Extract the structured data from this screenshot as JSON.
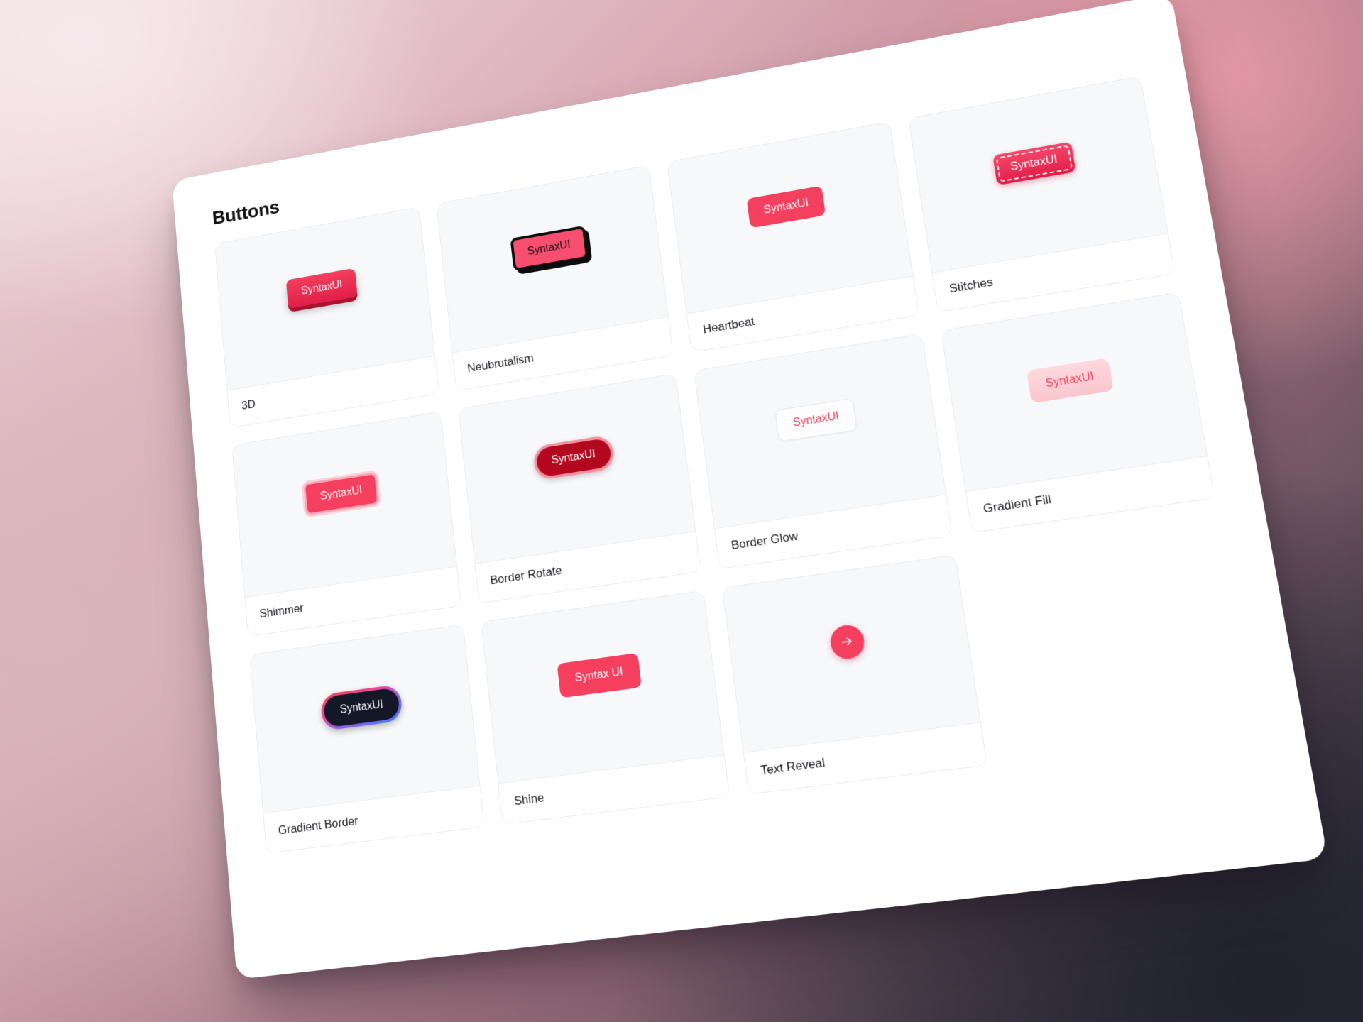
{
  "page": {
    "title": "Buttons",
    "accent_color": "#f43f5e",
    "panel_background": "#ffffff",
    "card_preview_background": "#f7f8fa",
    "background_colors": [
      "#f2dfe3",
      "#d9a9b4",
      "#9a6d7c",
      "#2b2c38"
    ]
  },
  "cards": [
    {
      "id": "3d",
      "label": "3D",
      "button_text": "SyntaxUI",
      "variant": "btn-3d",
      "button_colors": {
        "background": "#e11d48",
        "text": "#ffffff",
        "shadow": "#a8142f"
      }
    },
    {
      "id": "neubrutalism",
      "label": "Neubrutalism",
      "button_text": "SyntaxUI",
      "variant": "btn-neu",
      "button_colors": {
        "background": "#f84e6f",
        "text": "#111111",
        "border": "#0d0d0d"
      }
    },
    {
      "id": "heartbeat",
      "label": "Heartbeat",
      "button_text": "SyntaxUI",
      "variant": "btn-heartbeat",
      "button_colors": {
        "background": "#f43f5e",
        "text": "#ffffff"
      }
    },
    {
      "id": "stitches",
      "label": "Stitches",
      "button_text": "SyntaxUI",
      "variant": "btn-stitches",
      "button_colors": {
        "background": "#e11d48",
        "text": "#ffffff",
        "stitch": "#ffffff"
      }
    },
    {
      "id": "shimmer",
      "label": "Shimmer",
      "button_text": "SyntaxUI",
      "variant": "btn-shimmer",
      "button_colors": {
        "background": "#f43f5e",
        "text": "#ffffff",
        "glow": "#fda4b4"
      }
    },
    {
      "id": "border-rotate",
      "label": "Border Rotate",
      "button_text": "SyntaxUI",
      "variant": "btn-borderrotate",
      "button_colors": {
        "background": "#b2091f",
        "text": "#ffffff",
        "border": "#f7909f"
      }
    },
    {
      "id": "border-glow",
      "label": "Border Glow",
      "button_text": "SyntaxUI",
      "variant": "btn-borderglow",
      "button_colors": {
        "background": "#fdfdfe",
        "text": "#f43f5e",
        "border": "#e9e9ee"
      }
    },
    {
      "id": "gradient-fill",
      "label": "Gradient Fill",
      "button_text": "SyntaxUI",
      "variant": "btn-gradientfill",
      "button_colors": {
        "background": "#fdd9de",
        "text": "#f43f5e"
      }
    },
    {
      "id": "gradient-border",
      "label": "Gradient Border",
      "button_text": "SyntaxUI",
      "variant": "btn-gradientborder",
      "button_colors": {
        "background": "#131726",
        "text": "#ffffff",
        "border_from": "#f43f5e",
        "border_to": "#3b82f6"
      }
    },
    {
      "id": "shine",
      "label": "Shine",
      "button_text": "Syntax UI",
      "variant": "btn-shine",
      "button_colors": {
        "background": "#f43f5e",
        "text": "#ffffff"
      }
    },
    {
      "id": "text-reveal",
      "label": "Text Reveal",
      "button_text": "",
      "variant": "btn-textreveal",
      "icon": "arrow-right-icon",
      "button_colors": {
        "background": "#f43f5e",
        "text": "#ffffff"
      }
    }
  ]
}
